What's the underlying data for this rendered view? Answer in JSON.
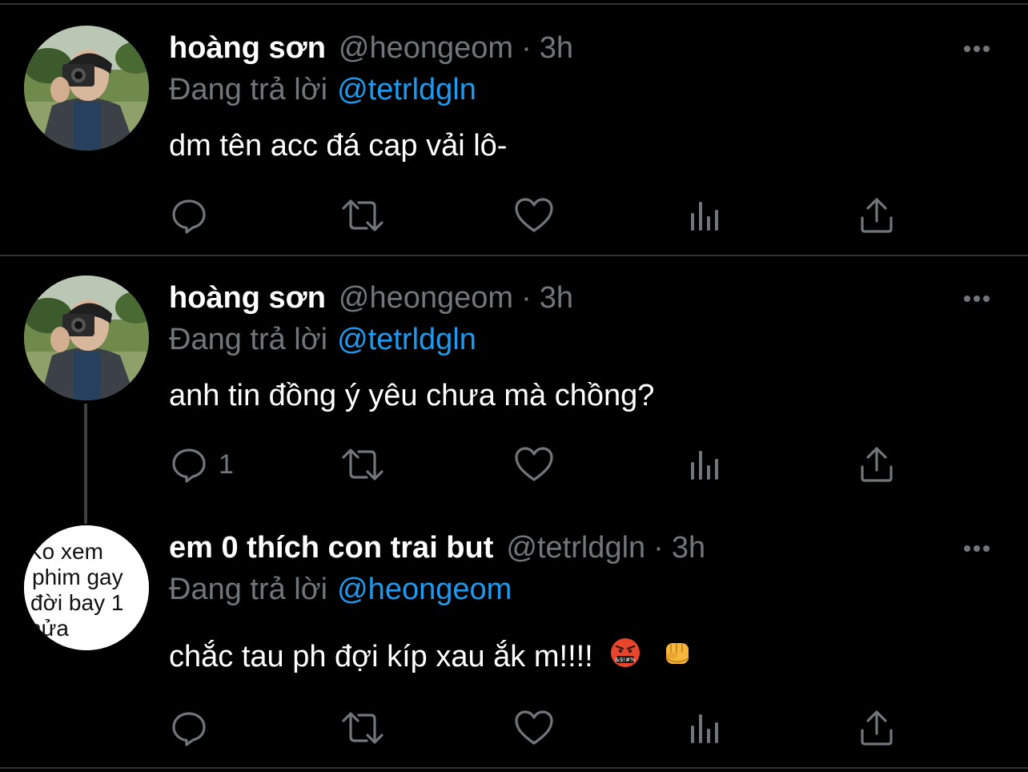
{
  "theme": {
    "background": "#000000",
    "text": "#ffffff",
    "muted": "#71767b",
    "link": "#1d9bf0",
    "divider": "#2f3336"
  },
  "tweets": [
    {
      "display_name": "hoàng sơn",
      "handle": "@heongeom",
      "separator": "·",
      "time": "3h",
      "replying_prefix": "Đang trả lời",
      "replying_to": "@tetrldgln",
      "text": "dm tên acc đá cap vải lô-",
      "reply_count": "",
      "avatar": "photo-avatar"
    },
    {
      "display_name": "hoàng sơn",
      "handle": "@heongeom",
      "separator": "·",
      "time": "3h",
      "replying_prefix": "Đang trả lời",
      "replying_to": "@tetrldgln",
      "text": "anh tin đồng ý yêu chưa mà chồng?",
      "reply_count": "1",
      "avatar": "photo-avatar"
    },
    {
      "display_name": "em 0 thích con trai but",
      "handle": "@tetrldgln",
      "separator": "·",
      "time": "3h",
      "replying_prefix": "Đang trả lời",
      "replying_to": "@heongeom",
      "text": "chắc tau ph đợi kíp xau ắk m!!!!",
      "emojis": [
        "cursing-face-emoji",
        "fist-emoji"
      ],
      "reply_count": "",
      "avatar": {
        "type": "text-avatar",
        "lines": [
          "Ko xem",
          "phim gay",
          "đời bay 1",
          "nửa"
        ]
      }
    }
  ],
  "icons": {
    "reply": "reply-icon",
    "retweet": "retweet-icon",
    "like": "heart-icon",
    "analytics": "analytics-icon",
    "share": "share-icon",
    "more": "more-icon"
  }
}
